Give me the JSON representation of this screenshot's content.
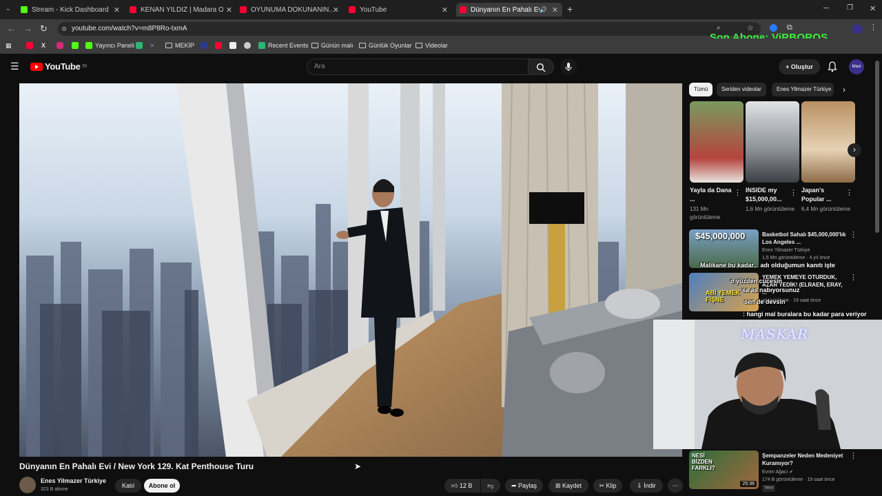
{
  "browser": {
    "tabs": [
      {
        "label": "Stream - Kick Dashboard",
        "color": "#53fc18"
      },
      {
        "label": "KENAN YILDIZ | Madara Olduk",
        "color": "#ff0033"
      },
      {
        "label": "OYUNUMA DOKUNANIN... - Yo",
        "color": "#ff0033"
      },
      {
        "label": "YouTube",
        "color": "#ff0033"
      },
      {
        "label": "Dünyanın En Pahalı Evi / Ne",
        "color": "#ff0033"
      }
    ],
    "url": "youtube.com/watch?v=m8P8Ro-txmA",
    "bookmarks": [
      "Yayıncı Paneli",
      "MEKİP",
      "Recent Events",
      "Günün malı",
      "Günlük Oyunlar",
      "Videolar"
    ],
    "overlay_text": "Son Abone: ViRBOROS"
  },
  "youtube": {
    "logo": "YouTube",
    "region": "TR",
    "search_placeholder": "Ara",
    "create_label": "Oluştur",
    "avatar_label": "Mavi"
  },
  "video": {
    "title": "Dünyanın En Pahalı Evi / New York 129. Kat Penthouse Turu",
    "channel": "Enes Yilmazer Türkiye",
    "subscribers": "323 B abone",
    "join_label": "Katıl",
    "subscribe_label": "Abone ol",
    "likes": "12 B",
    "share_label": "Paylaş",
    "save_label": "Kaydet",
    "clip_label": "Klip",
    "download_label": "İndir"
  },
  "sidebar": {
    "chips": [
      "Tümü",
      "Seriden videolar",
      "Enes Yilmazer Türkiye"
    ],
    "shorts": [
      {
        "title": "Yayla da Dana ...",
        "views": "131 Mn görüntüleme"
      },
      {
        "title": "INSIDE my $15,000,00...",
        "views": "1,6 Mn görüntüleme"
      },
      {
        "title": "Japan's Popular ...",
        "views": "6,4 Mn görüntüleme"
      }
    ],
    "videos": [
      {
        "title": "Basketbol Sahalı $45,000,000'lık Los Angeles ...",
        "channel": "Enes Yilmazer Türkiye",
        "meta": "1,6 Mn görüntüleme · 4 yıl önce",
        "thumb_text": "$45,000,000"
      },
      {
        "title": "YEMEK YEMEYE OTURDUK, AZAR YEDİK! (ELRAEN, ERAY, ...",
        "channel": "",
        "meta": "görüntüleme · 19 saat önce",
        "thumb_text": "ABİ YEMEK FİŞNE"
      },
      {
        "title": "Şempanzeler Neden Medeniyet Kuramıyor?",
        "channel": "Evrim Ağacı",
        "meta": "174 B görüntüleme · 19 saat önce",
        "badge": "Yeni",
        "duration": "25:36",
        "thumb_text": "NESİ BİZDEN FARKLI?"
      }
    ],
    "chat_overlay": [
      "Malikane bu kadar... adı olduğumun kanıtı işte",
      "o yüzden cücesin",
      "sa as nabıyorsunuz",
      "sen de devsin",
      ": hangi mal buralara bu kadar para veriyor"
    ],
    "webcam_label": "MASKAR"
  }
}
